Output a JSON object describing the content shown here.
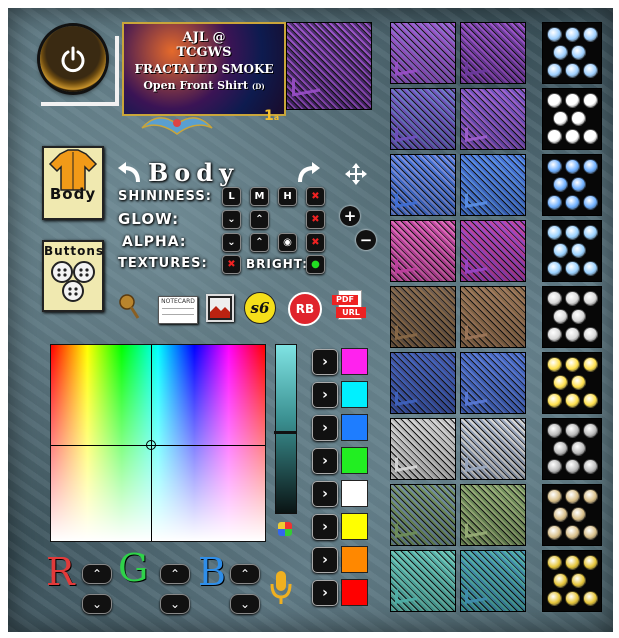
{
  "brand": {
    "line1": "AJL @",
    "line2": "TCGWS",
    "line3": "FRACTALED SMOKE",
    "line4": "Open Front Shirt",
    "line4_tag": "(D)"
  },
  "page": {
    "number": "1",
    "suffix": "a"
  },
  "section": {
    "title": "Body"
  },
  "sidebar": {
    "body_label": "Body",
    "buttons_label": "Buttons"
  },
  "controls": {
    "shininess": {
      "label": "SHININESS:",
      "low": "L",
      "medium": "M",
      "high": "H",
      "off": "✖"
    },
    "glow": {
      "label": "GLOW:",
      "down": "⌄",
      "up": "⌃",
      "off": "✖"
    },
    "alpha": {
      "label": "ALPHA:",
      "down": "⌄",
      "up": "⌃",
      "toggle": "◉",
      "off": "✖"
    },
    "textures": {
      "label": "TEXTURES:",
      "off": "✖"
    },
    "bright": {
      "label": "BRIGHT:",
      "on": "●"
    }
  },
  "tools": {
    "notecard": "NOTECARD",
    "s6": "s6",
    "rb": "RB",
    "pdf_top": "PDF",
    "pdf_bottom": "URL"
  },
  "rgb": {
    "r": "R",
    "g": "G",
    "b": "B"
  },
  "swatches": [
    "#ff22ee",
    "#00f0ff",
    "#1e7dff",
    "#22ee22",
    "#ffffff",
    "#ffff00",
    "#ff8800",
    "#ff0000"
  ],
  "shirt_colors": [
    [
      "#9a4fc9",
      "#6c3a9e",
      "#8e6bd0"
    ],
    [
      "#7050c0",
      "#a05fd0",
      "#6a78c8"
    ],
    [
      "#3f6fd8",
      "#5a90e8",
      "#7a8fe0"
    ],
    [
      "#c03fa0",
      "#9a45c8",
      "#e06ab8"
    ],
    [
      "#8b6a48",
      "#a0785a",
      "#6e5a4a"
    ],
    [
      "#3f63c0",
      "#5a7ad8",
      "#4050a0"
    ],
    [
      "#d8d8d8",
      "#9aa8c0",
      "#bfbfbf"
    ],
    [
      "#70905a",
      "#9ab078",
      "#6f8da0"
    ],
    [
      "#4fb0a8",
      "#3f8fb0",
      "#70c8b8"
    ]
  ],
  "button_colors": [
    "#9fd0ff",
    "#ffffff",
    "#6fb0ff",
    "#9ad1ff",
    "#d9d9d9",
    "#ffe14d",
    "#bdbdbd",
    "#d9c08a",
    "#e6c63a",
    "#ff6a6a"
  ]
}
